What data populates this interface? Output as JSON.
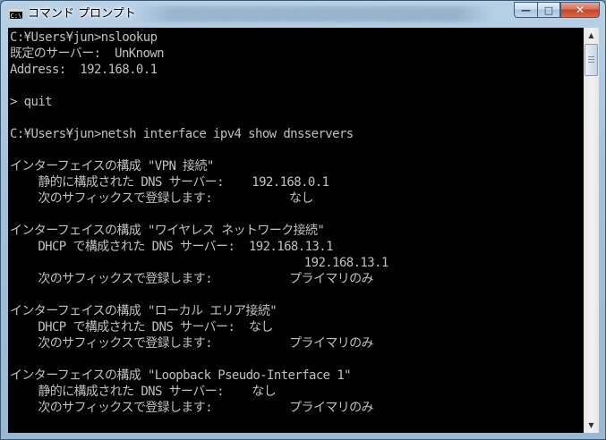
{
  "window": {
    "title": "コマンド プロンプト",
    "app_icon_label": "C:\\",
    "buttons": {
      "minimize": "—",
      "maximize": "□",
      "close": "✕"
    }
  },
  "console": {
    "lines": [
      "C:¥Users¥jun>nslookup",
      "既定のサーバー:  UnKnown",
      "Address:  192.168.0.1",
      "",
      "> quit",
      "",
      "C:¥Users¥jun>netsh interface ipv4 show dnsservers",
      "",
      "インターフェイスの構成 \"VPN 接続\"",
      "    静的に構成された DNS サーバー:    192.168.0.1",
      "    次のサフィックスで登録します:           なし",
      "",
      "インターフェイスの構成 \"ワイヤレス ネットワーク接続\"",
      "    DHCP で構成された DNS サーバー:  192.168.13.1",
      "                                          192.168.13.1",
      "    次のサフィックスで登録します:           プライマリのみ",
      "",
      "インターフェイスの構成 \"ローカル エリア接続\"",
      "    DHCP で構成された DNS サーバー:  なし",
      "    次のサフィックスで登録します:           プライマリのみ",
      "",
      "インターフェイスの構成 \"Loopback Pseudo-Interface 1\"",
      "    静的に構成された DNS サーバー:    なし",
      "    次のサフィックスで登録します:           プライマリのみ",
      ""
    ]
  },
  "scrollbar": {
    "up_arrow": "▲",
    "down_arrow": "▼"
  },
  "colors": {
    "console_background": "#000000",
    "console_text": "#c0c0c0",
    "close_button": "#c2452a"
  }
}
